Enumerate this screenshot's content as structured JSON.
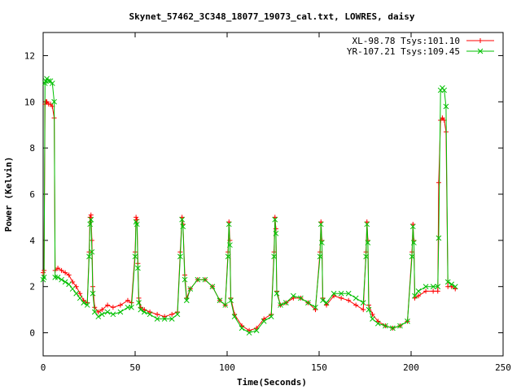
{
  "chart_data": {
    "type": "line",
    "title": "Skynet_57462_3C348_18077_19073_cal.txt, LOWRES, daisy",
    "xlabel": "Time(Seconds)",
    "ylabel": "Power (Kelvin)",
    "xlim": [
      0,
      250
    ],
    "ylim": [
      -1,
      13
    ],
    "xticks": [
      0,
      50,
      100,
      150,
      200,
      250
    ],
    "yticks": [
      0,
      2,
      4,
      6,
      8,
      10,
      12
    ],
    "grid": false,
    "legend_position": "top-right",
    "series": [
      {
        "name": "XL-98.78 Tsys:101.10",
        "color": "#ff0000",
        "marker": "plus",
        "x": [
          0,
          0.5,
          1,
          1.5,
          2,
          3,
          4,
          5,
          6,
          6.5,
          8,
          10,
          12,
          14,
          16,
          18,
          20,
          22,
          24,
          25,
          25.5,
          26,
          26.5,
          27,
          28,
          30,
          32,
          35,
          38,
          42,
          46,
          48,
          50,
          50.5,
          51,
          51.5,
          52,
          53,
          55,
          58,
          62,
          66,
          70,
          73,
          74.5,
          75.5,
          76,
          77,
          78,
          80,
          84,
          88,
          92,
          96,
          99,
          100.5,
          101,
          101.5,
          102,
          104,
          108,
          112,
          116,
          120,
          124,
          125.5,
          126,
          126.5,
          127,
          129,
          132,
          136,
          140,
          144,
          148,
          150.5,
          151,
          151.5,
          152,
          154,
          158,
          162,
          166,
          170,
          174,
          175.5,
          176,
          176.5,
          177,
          179,
          182,
          186,
          190,
          194,
          198,
          200.5,
          201,
          201.5,
          202,
          204,
          208,
          212,
          214.5,
          215,
          216,
          217,
          218,
          219,
          220,
          222,
          224
        ],
        "y": [
          2.6,
          2.7,
          9.9,
          10.0,
          10.0,
          9.9,
          9.9,
          9.8,
          9.3,
          2.7,
          2.8,
          2.7,
          2.6,
          2.5,
          2.2,
          2.0,
          1.7,
          1.4,
          1.3,
          3.5,
          5.0,
          5.1,
          4.0,
          2.0,
          1.1,
          0.9,
          1.0,
          1.2,
          1.1,
          1.2,
          1.4,
          1.3,
          3.5,
          5.0,
          4.9,
          3.0,
          1.5,
          1.1,
          1.0,
          0.9,
          0.8,
          0.7,
          0.8,
          0.9,
          3.5,
          5.0,
          4.7,
          2.5,
          1.5,
          1.9,
          2.3,
          2.3,
          2.0,
          1.4,
          1.2,
          3.5,
          4.8,
          4.0,
          1.5,
          0.8,
          0.3,
          0.1,
          0.2,
          0.6,
          0.8,
          3.5,
          5.0,
          4.5,
          1.8,
          1.2,
          1.3,
          1.5,
          1.5,
          1.3,
          1.0,
          3.5,
          4.8,
          4.0,
          1.5,
          1.2,
          1.6,
          1.5,
          1.4,
          1.2,
          1.0,
          3.5,
          4.8,
          4.0,
          1.2,
          0.8,
          0.5,
          0.3,
          0.2,
          0.3,
          0.5,
          3.5,
          4.7,
          4.0,
          1.5,
          1.6,
          1.8,
          1.8,
          1.8,
          6.5,
          9.2,
          9.3,
          9.2,
          8.7,
          2.0,
          2.0,
          1.9
        ]
      },
      {
        "name": "YR-107.21 Tsys:109.45",
        "color": "#00c000",
        "marker": "cross",
        "x": [
          0,
          0.5,
          1,
          1.5,
          2,
          3,
          4,
          5,
          6,
          6.5,
          8,
          10,
          12,
          14,
          16,
          18,
          20,
          22,
          24,
          25,
          25.5,
          26,
          26.5,
          27,
          28,
          30,
          32,
          35,
          38,
          42,
          46,
          48,
          50,
          50.5,
          51,
          51.5,
          52,
          53,
          55,
          58,
          62,
          66,
          70,
          73,
          74.5,
          75.5,
          76,
          77,
          78,
          80,
          84,
          88,
          92,
          96,
          99,
          100.5,
          101,
          101.5,
          102,
          104,
          108,
          112,
          116,
          120,
          124,
          125.5,
          126,
          126.5,
          127,
          129,
          132,
          136,
          140,
          144,
          148,
          150.5,
          151,
          151.5,
          152,
          154,
          158,
          162,
          166,
          170,
          174,
          175.5,
          176,
          176.5,
          177,
          179,
          182,
          186,
          190,
          194,
          198,
          200.5,
          201,
          201.5,
          202,
          204,
          208,
          212,
          214.5,
          215,
          216,
          217,
          218,
          219,
          220,
          222,
          224
        ],
        "y": [
          2.3,
          2.4,
          10.8,
          10.9,
          11.0,
          10.9,
          10.9,
          10.8,
          10.0,
          2.4,
          2.4,
          2.3,
          2.2,
          2.1,
          1.9,
          1.7,
          1.5,
          1.3,
          1.2,
          3.3,
          4.7,
          4.9,
          3.5,
          1.7,
          0.9,
          0.7,
          0.8,
          0.9,
          0.8,
          0.9,
          1.1,
          1.1,
          3.3,
          4.8,
          4.7,
          2.8,
          1.3,
          1.0,
          0.9,
          0.8,
          0.6,
          0.6,
          0.6,
          0.8,
          3.3,
          4.9,
          4.6,
          2.3,
          1.4,
          1.9,
          2.3,
          2.3,
          2.0,
          1.4,
          1.2,
          3.3,
          4.7,
          3.8,
          1.4,
          0.7,
          0.2,
          0.0,
          0.1,
          0.5,
          0.7,
          3.3,
          4.9,
          4.3,
          1.7,
          1.2,
          1.3,
          1.6,
          1.5,
          1.3,
          1.1,
          3.3,
          4.7,
          3.9,
          1.4,
          1.3,
          1.7,
          1.7,
          1.7,
          1.5,
          1.3,
          3.3,
          4.7,
          3.9,
          1.0,
          0.6,
          0.4,
          0.3,
          0.2,
          0.3,
          0.5,
          3.3,
          4.6,
          3.9,
          1.6,
          1.8,
          2.0,
          2.0,
          2.0,
          4.1,
          10.5,
          10.6,
          10.5,
          9.8,
          2.2,
          2.1,
          2.0
        ]
      }
    ]
  }
}
